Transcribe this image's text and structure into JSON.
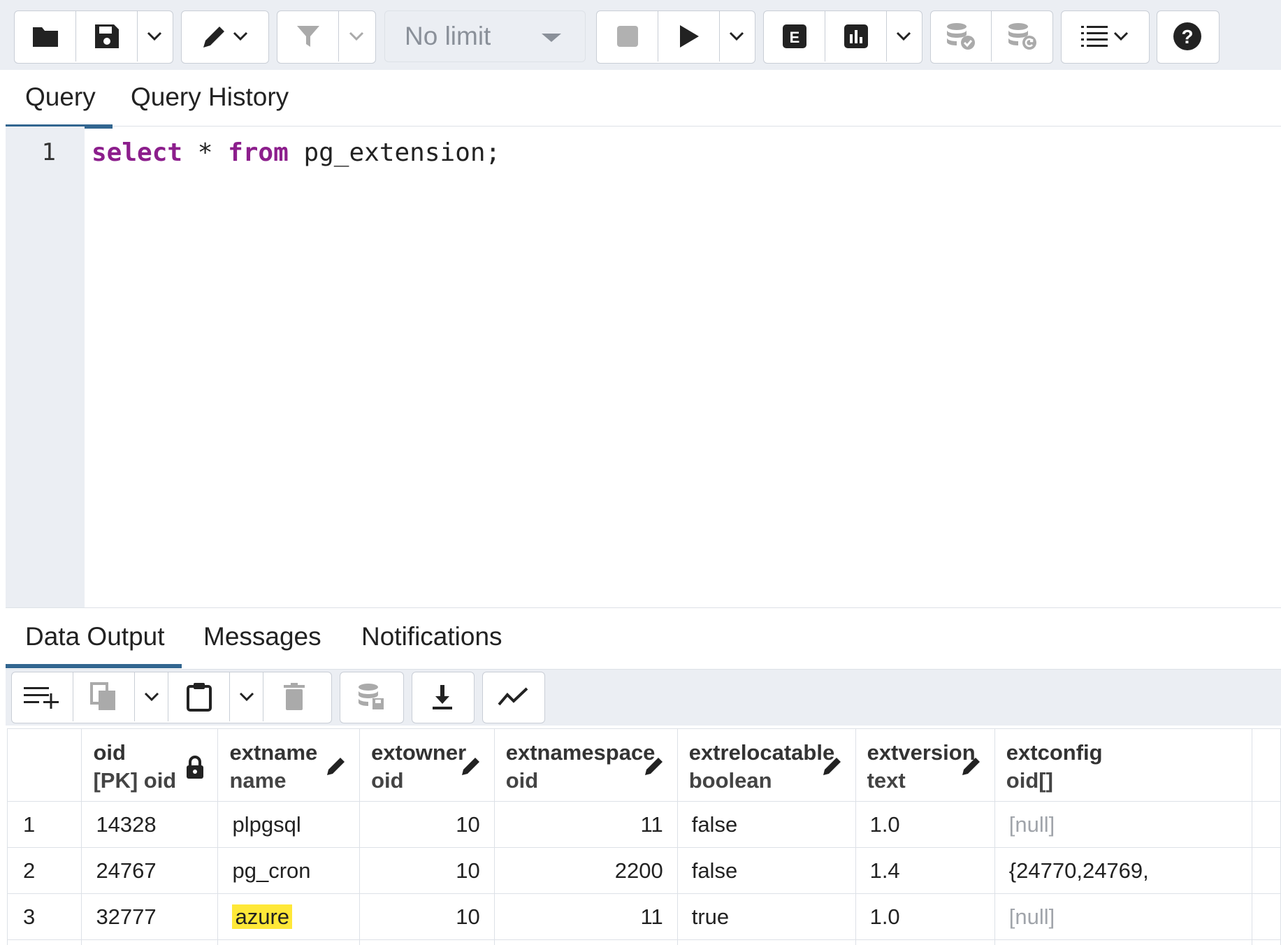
{
  "toolbar": {
    "limit_label": "No limit"
  },
  "query_tabs": [
    {
      "label": "Query",
      "active": true
    },
    {
      "label": "Query History",
      "active": false
    }
  ],
  "editor": {
    "line_number": "1",
    "kw_select": "select",
    "star": " * ",
    "kw_from": "from",
    "rest": " pg_extension;"
  },
  "output_tabs": [
    {
      "label": "Data Output",
      "active": true
    },
    {
      "label": "Messages",
      "active": false
    },
    {
      "label": "Notifications",
      "active": false
    }
  ],
  "grid": {
    "columns": [
      {
        "name": "oid",
        "type": "[PK] oid",
        "icon": "lock-icon"
      },
      {
        "name": "extname",
        "type": "name",
        "icon": "pencil-icon"
      },
      {
        "name": "extowner",
        "type": "oid",
        "icon": "pencil-icon"
      },
      {
        "name": "extnamespace",
        "type": "oid",
        "icon": "pencil-icon"
      },
      {
        "name": "extrelocatable",
        "type": "boolean",
        "icon": "pencil-icon"
      },
      {
        "name": "extversion",
        "type": "text",
        "icon": "pencil-icon"
      },
      {
        "name": "extconfig",
        "type": "oid[]",
        "icon": ""
      }
    ],
    "rows": [
      {
        "n": "1",
        "oid": "14328",
        "extname": "plpgsql",
        "extowner": "10",
        "extnamespace": "11",
        "extrelocatable": "false",
        "extversion": "1.0",
        "extconfig": "[null]"
      },
      {
        "n": "2",
        "oid": "24767",
        "extname": "pg_cron",
        "extowner": "10",
        "extnamespace": "2200",
        "extrelocatable": "false",
        "extversion": "1.4",
        "extconfig": "{24770,24769,"
      },
      {
        "n": "3",
        "oid": "32777",
        "extname": "azure",
        "extowner": "10",
        "extnamespace": "11",
        "extrelocatable": "true",
        "extversion": "1.0",
        "extconfig": "[null]"
      }
    ],
    "highlight_color": "#ffe838"
  }
}
